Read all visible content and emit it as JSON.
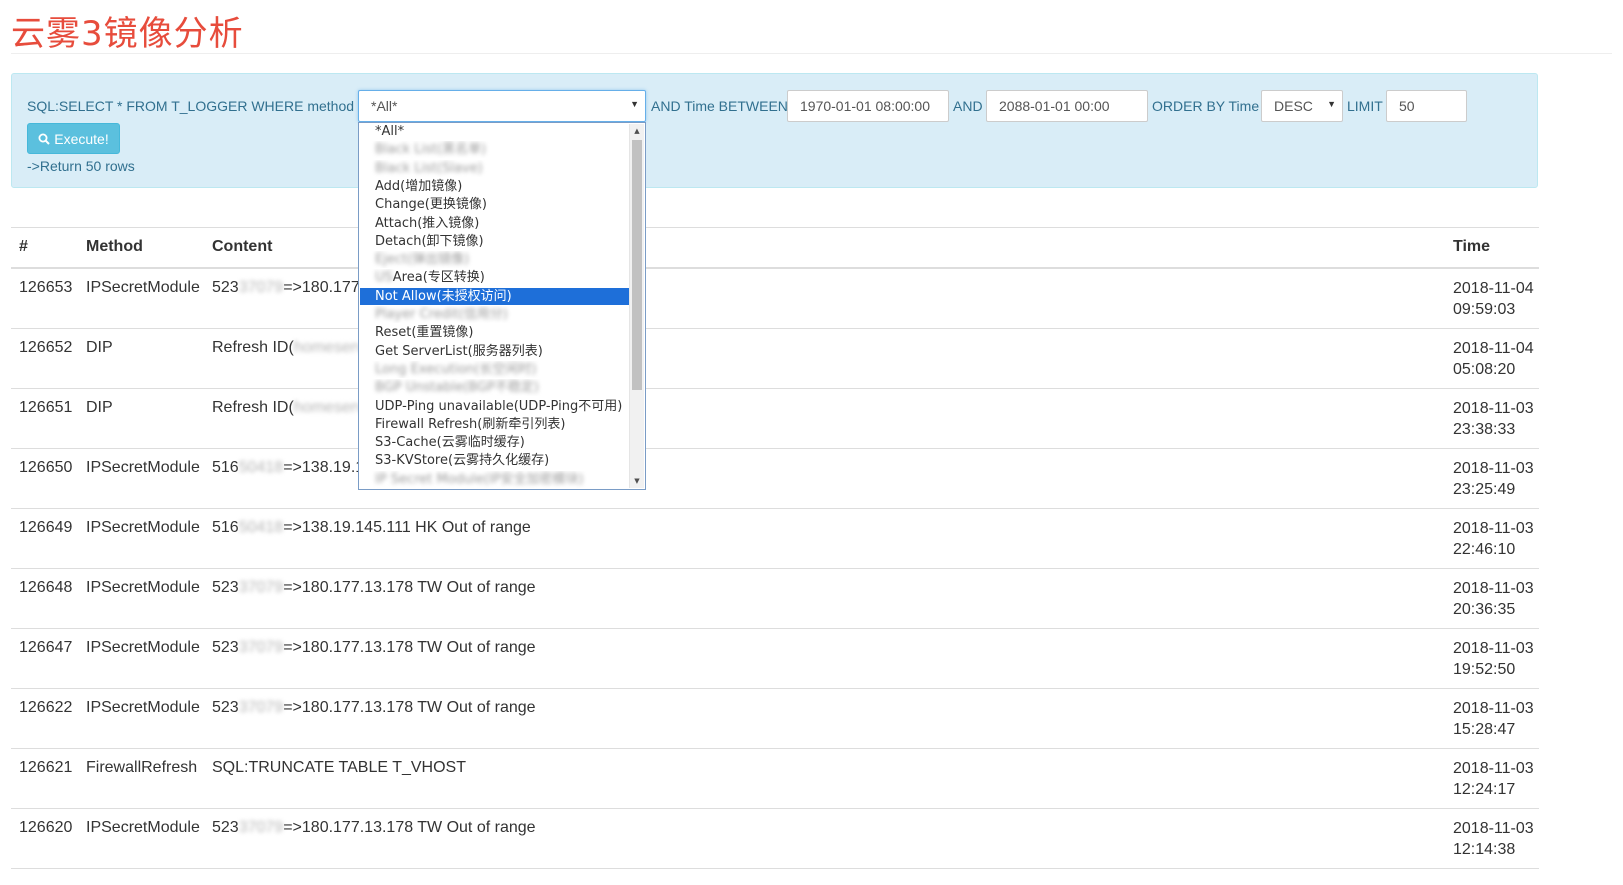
{
  "page": {
    "title": "云雾3镜像分析"
  },
  "query": {
    "sql_prefix": "SQL:SELECT * FROM T_LOGGER WHERE method =",
    "method_value": "*All*",
    "and_time_between": "AND Time BETWEEN",
    "time_from": "1970-01-01 08:00:00",
    "and_label": "AND",
    "time_to": "2088-01-01 00:00",
    "order_by_label": "ORDER BY Time",
    "order_value": "DESC",
    "limit_label": "LIMIT",
    "limit_value": "50",
    "execute_label": "Execute!",
    "return_text": "->Return 50 rows"
  },
  "dropdown": {
    "options": [
      {
        "label": "*All*"
      },
      {
        "label": "Black List(黑名单)",
        "blurred": true
      },
      {
        "label": "Black List(Slave)",
        "blurred": true
      },
      {
        "label": "Add(增加镜像)"
      },
      {
        "label": "Change(更换镜像)"
      },
      {
        "label": "Attach(推入镜像)"
      },
      {
        "label": "Detach(卸下镜像)"
      },
      {
        "label": "Eject(弹出镜像)",
        "blurred": true
      },
      {
        "prefix": "US",
        "label": "Area(专区转换)",
        "prefix_blurred": true
      },
      {
        "label": "Not Allow(未授权访问)",
        "selected": true
      },
      {
        "label": "Player Credit(信用分)",
        "blurred": true
      },
      {
        "label": "Reset(重置镜像)"
      },
      {
        "label": "Get ServerList(服务器列表)"
      },
      {
        "label": "Long Execution(长空闲时)",
        "blurred": true
      },
      {
        "label": "BGP Unstable(BGP不稳定)",
        "blurred": true
      },
      {
        "label": "UDP-Ping unavailable(UDP-Ping不可用)"
      },
      {
        "label": "Firewall Refresh(刷新牵引列表)"
      },
      {
        "label": "S3-Cache(云雾临时缓存)"
      },
      {
        "label": "S3-KVStore(云雾持久化缓存)"
      },
      {
        "label": "IP Secret Module(IP安全加密模块)",
        "blurred": true
      }
    ]
  },
  "table": {
    "headers": [
      "#",
      "Method",
      "Content",
      "Time"
    ],
    "rows": [
      {
        "id": "126653",
        "method": "IPSecretModule",
        "c_pre": "523",
        "c_blur": "37079",
        "c_post": "=>180.177.",
        "date": "2018-11-04",
        "clock": "09:59:03"
      },
      {
        "id": "126652",
        "method": "DIP",
        "c_pre": "Refresh ID(",
        "c_blur": "homeserv",
        "c_post": "",
        "date": "2018-11-04",
        "clock": "05:08:20"
      },
      {
        "id": "126651",
        "method": "DIP",
        "c_pre": "Refresh ID(",
        "c_blur": "homeserv",
        "c_post": "",
        "date": "2018-11-03",
        "clock": "23:38:33"
      },
      {
        "id": "126650",
        "method": "IPSecretModule",
        "c_pre": "516",
        "c_blur": "50418",
        "c_post": "=>138.19.1",
        "date": "2018-11-03",
        "clock": "23:25:49"
      },
      {
        "id": "126649",
        "method": "IPSecretModule",
        "c_pre": "516",
        "c_blur": "50418",
        "c_post": "=>138.19.145.111 HK Out of range",
        "date": "2018-11-03",
        "clock": "22:46:10"
      },
      {
        "id": "126648",
        "method": "IPSecretModule",
        "c_pre": "523",
        "c_blur": "37079",
        "c_post": "=>180.177.13.178 TW Out of range",
        "date": "2018-11-03",
        "clock": "20:36:35"
      },
      {
        "id": "126647",
        "method": "IPSecretModule",
        "c_pre": "523",
        "c_blur": "37079",
        "c_post": "=>180.177.13.178 TW Out of range",
        "date": "2018-11-03",
        "clock": "19:52:50"
      },
      {
        "id": "126622",
        "method": "IPSecretModule",
        "c_pre": "523",
        "c_blur": "37079",
        "c_post": "=>180.177.13.178 TW Out of range",
        "date": "2018-11-03",
        "clock": "15:28:47"
      },
      {
        "id": "126621",
        "method": "FirewallRefresh",
        "c_pre": "SQL:TRUNCATE TABLE T_VHOST",
        "c_blur": "",
        "c_post": "",
        "date": "2018-11-03",
        "clock": "12:24:17"
      },
      {
        "id": "126620",
        "method": "IPSecretModule",
        "c_pre": "523",
        "c_blur": "37079",
        "c_post": "=>180.177.13.178 TW Out of range",
        "date": "2018-11-03",
        "clock": "12:14:38"
      }
    ]
  },
  "colors": {
    "title": "#e74c3c",
    "panel_bg": "#d9edf7",
    "panel_text": "#31708f",
    "button": "#5bc0de",
    "selected_option": "#1e6fd9"
  },
  "icons": {
    "execute": "search-icon"
  }
}
